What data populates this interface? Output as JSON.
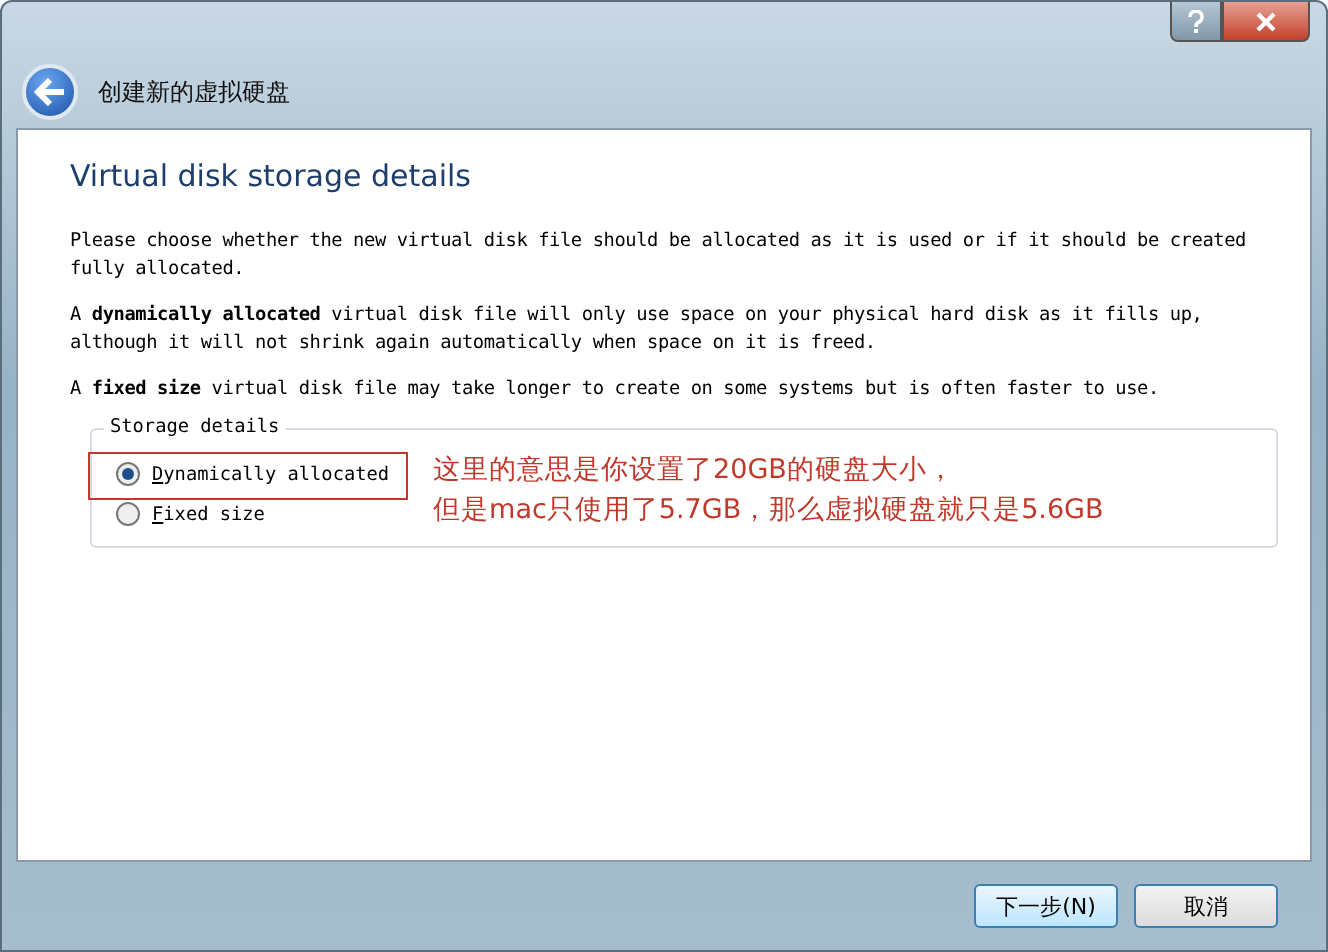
{
  "window": {
    "title": "创建新的虚拟硬盘"
  },
  "page": {
    "heading": "Virtual disk storage details",
    "paragraphs": [
      "Please choose whether the new virtual disk file should be allocated as it is used or if it should be created fully allocated.",
      "A **dynamically allocated** virtual disk file will only use space on your physical hard disk as it fills up, although it will not shrink again automatically when space on it is freed.",
      "A **fixed size** virtual disk file may take longer to create on some systems but is often faster to use."
    ]
  },
  "storage_details": {
    "title": "Storage details",
    "options": [
      {
        "label": "Dynamically allocated",
        "selected": true
      },
      {
        "label": "Fixed size",
        "selected": false
      }
    ]
  },
  "annotation": {
    "lines": [
      "这里的意思是你设置了20GB的硬盘大小，",
      "但是mac只使用了5.7GB，那么虚拟硬盘就只是5.6GB"
    ]
  },
  "buttons": [
    "下一步(N)",
    "取消"
  ]
}
